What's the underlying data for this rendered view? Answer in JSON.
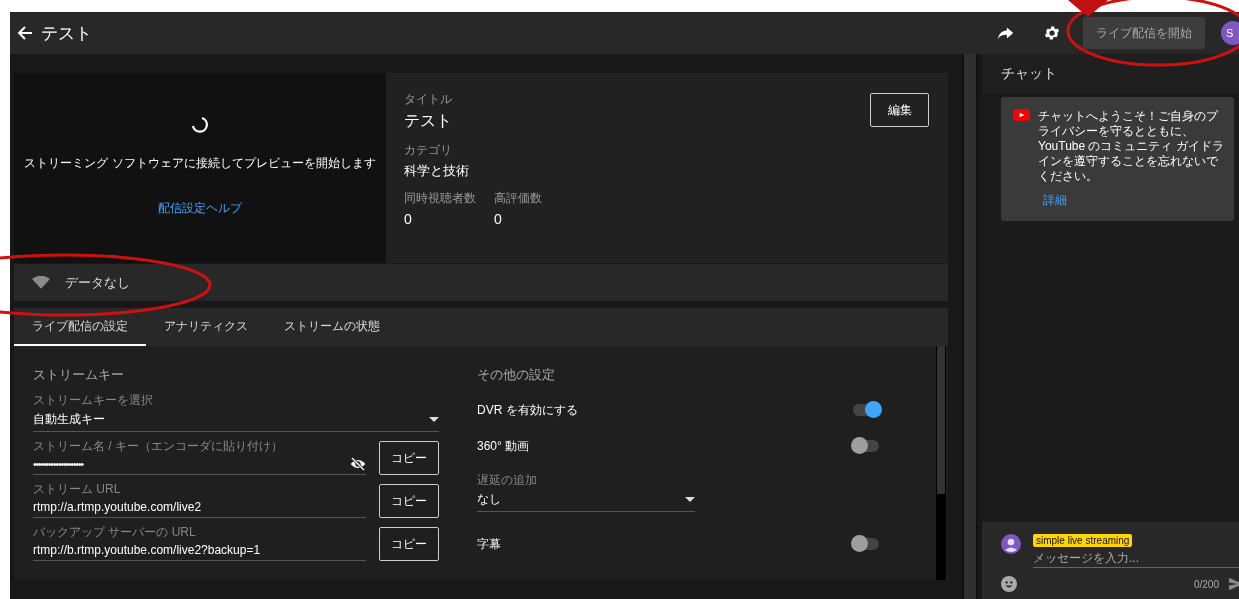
{
  "header": {
    "title": "テスト",
    "start_button": "ライブ配信を開始",
    "avatar_letter": "S"
  },
  "preview": {
    "message": "ストリーミング ソフトウェアに接続してプレビューを開始します",
    "help_link": "配信設定ヘルプ"
  },
  "details": {
    "fields": [
      {
        "label": "タイトル",
        "value": "テスト"
      },
      {
        "label": "カテゴリ",
        "value": "科学と技術"
      }
    ],
    "stats": [
      {
        "label": "同時視聴者数",
        "value": "0"
      },
      {
        "label": "高評価数",
        "value": "0"
      }
    ],
    "edit_button": "編集"
  },
  "health": {
    "text": "データなし"
  },
  "tabs": [
    {
      "label": "ライブ配信の設定",
      "selected": true
    },
    {
      "label": "アナリティクス",
      "selected": false
    },
    {
      "label": "ストリームの状態",
      "selected": false
    }
  ],
  "stream_key": {
    "heading": "ストリームキー",
    "fields": [
      {
        "kind": "select",
        "label": "ストリームキーを選択",
        "value": "自動生成キー"
      },
      {
        "kind": "secret",
        "label": "ストリーム名 / キー（エンコーダに貼り付け）",
        "value": "••••••••••••••••••••",
        "copy": "コピー"
      },
      {
        "kind": "text",
        "label": "ストリーム URL",
        "value": "rtmp://a.rtmp.youtube.com/live2",
        "copy": "コピー"
      },
      {
        "kind": "text",
        "label": "バックアップ サーバーの URL",
        "value": "rtmp://b.rtmp.youtube.com/live2?backup=1",
        "copy": "コピー"
      }
    ]
  },
  "other": {
    "heading": "その他の設定",
    "settings": [
      {
        "kind": "toggle",
        "label": "DVR を有効にする",
        "on": true
      },
      {
        "kind": "toggle",
        "label": "360° 動画",
        "on": false
      },
      {
        "kind": "select",
        "label": "遅延の追加",
        "value": "なし"
      },
      {
        "kind": "toggle",
        "label": "字幕",
        "on": false
      }
    ]
  },
  "chat": {
    "title": "チャット",
    "welcome": "チャットへようこそ！ご自身のプライバシーを守るとともに、YouTube のコミュニティ ガイドラインを遵守することを忘れないでください。",
    "details_link": "詳細",
    "user_name": "simple live streaming",
    "placeholder": "メッセージを入力...",
    "counter": "0/200"
  }
}
